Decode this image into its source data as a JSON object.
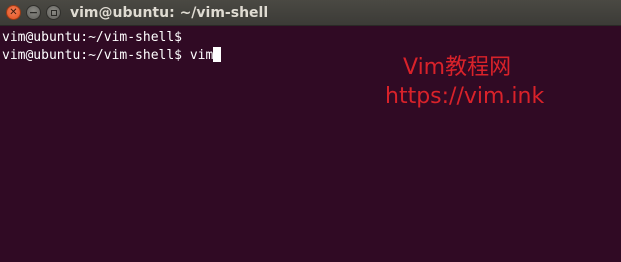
{
  "window": {
    "title": "vim@ubuntu: ~/vim-shell",
    "buttons": {
      "close_glyph": "✕",
      "minimize_glyph": "−"
    }
  },
  "terminal": {
    "lines": [
      {
        "prompt": "vim@ubuntu:~/vim-shell$",
        "command": ""
      },
      {
        "prompt": "vim@ubuntu:~/vim-shell$",
        "command": " vim"
      }
    ],
    "colors": {
      "background": "#300a24",
      "text": "#ffffff"
    }
  },
  "watermark": {
    "line1": "Vim教程网",
    "line2": "https://vim.ink",
    "color": "#d9222a"
  }
}
